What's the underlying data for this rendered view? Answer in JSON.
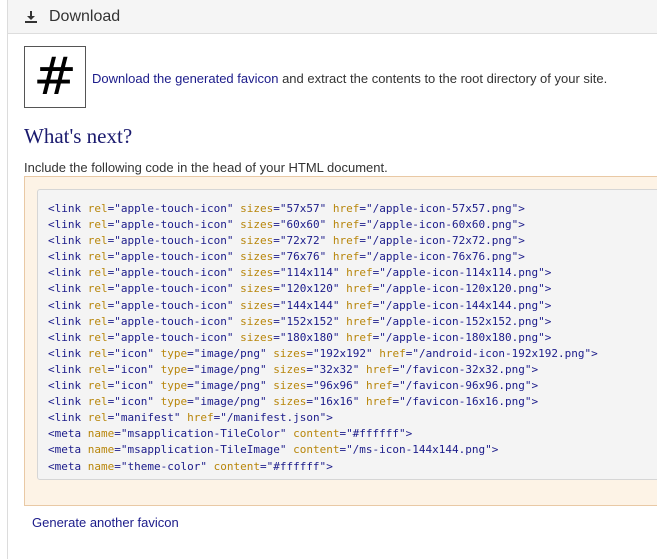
{
  "header": {
    "title": "Download",
    "icon": "download-icon"
  },
  "favicon": {
    "glyph": "#",
    "link_text": "Download the generated favicon",
    "rest_text": " and extract the contents to the root directory of your site."
  },
  "next": {
    "heading": "What's next?",
    "include_text": "Include the following code in the head of your HTML document."
  },
  "code_lines": [
    [
      "link",
      [
        [
          "rel",
          "apple-touch-icon"
        ],
        [
          "sizes",
          "57x57"
        ],
        [
          "href",
          "/apple-icon-57x57.png"
        ]
      ]
    ],
    [
      "link",
      [
        [
          "rel",
          "apple-touch-icon"
        ],
        [
          "sizes",
          "60x60"
        ],
        [
          "href",
          "/apple-icon-60x60.png"
        ]
      ]
    ],
    [
      "link",
      [
        [
          "rel",
          "apple-touch-icon"
        ],
        [
          "sizes",
          "72x72"
        ],
        [
          "href",
          "/apple-icon-72x72.png"
        ]
      ]
    ],
    [
      "link",
      [
        [
          "rel",
          "apple-touch-icon"
        ],
        [
          "sizes",
          "76x76"
        ],
        [
          "href",
          "/apple-icon-76x76.png"
        ]
      ]
    ],
    [
      "link",
      [
        [
          "rel",
          "apple-touch-icon"
        ],
        [
          "sizes",
          "114x114"
        ],
        [
          "href",
          "/apple-icon-114x114.png"
        ]
      ]
    ],
    [
      "link",
      [
        [
          "rel",
          "apple-touch-icon"
        ],
        [
          "sizes",
          "120x120"
        ],
        [
          "href",
          "/apple-icon-120x120.png"
        ]
      ]
    ],
    [
      "link",
      [
        [
          "rel",
          "apple-touch-icon"
        ],
        [
          "sizes",
          "144x144"
        ],
        [
          "href",
          "/apple-icon-144x144.png"
        ]
      ]
    ],
    [
      "link",
      [
        [
          "rel",
          "apple-touch-icon"
        ],
        [
          "sizes",
          "152x152"
        ],
        [
          "href",
          "/apple-icon-152x152.png"
        ]
      ]
    ],
    [
      "link",
      [
        [
          "rel",
          "apple-touch-icon"
        ],
        [
          "sizes",
          "180x180"
        ],
        [
          "href",
          "/apple-icon-180x180.png"
        ]
      ]
    ],
    [
      "link",
      [
        [
          "rel",
          "icon"
        ],
        [
          "type",
          "image/png"
        ],
        [
          "sizes",
          "192x192"
        ],
        [
          "href",
          "/android-icon-192x192.png"
        ]
      ]
    ],
    [
      "link",
      [
        [
          "rel",
          "icon"
        ],
        [
          "type",
          "image/png"
        ],
        [
          "sizes",
          "32x32"
        ],
        [
          "href",
          "/favicon-32x32.png"
        ]
      ]
    ],
    [
      "link",
      [
        [
          "rel",
          "icon"
        ],
        [
          "type",
          "image/png"
        ],
        [
          "sizes",
          "96x96"
        ],
        [
          "href",
          "/favicon-96x96.png"
        ]
      ]
    ],
    [
      "link",
      [
        [
          "rel",
          "icon"
        ],
        [
          "type",
          "image/png"
        ],
        [
          "sizes",
          "16x16"
        ],
        [
          "href",
          "/favicon-16x16.png"
        ]
      ]
    ],
    [
      "link",
      [
        [
          "rel",
          "manifest"
        ],
        [
          "href",
          "/manifest.json"
        ]
      ]
    ],
    [
      "meta",
      [
        [
          "name",
          "msapplication-TileColor"
        ],
        [
          "content",
          "#ffffff"
        ]
      ]
    ],
    [
      "meta",
      [
        [
          "name",
          "msapplication-TileImage"
        ],
        [
          "content",
          "/ms-icon-144x144.png"
        ]
      ]
    ],
    [
      "meta",
      [
        [
          "name",
          "theme-color"
        ],
        [
          "content",
          "#ffffff"
        ]
      ]
    ]
  ],
  "footer": {
    "generate_link": "Generate another favicon"
  },
  "colors": {
    "tag": "#1b1b8a",
    "attr": "#b8860b",
    "code_bg": "#f4f4f4",
    "outer_bg": "#fdf3e6"
  }
}
